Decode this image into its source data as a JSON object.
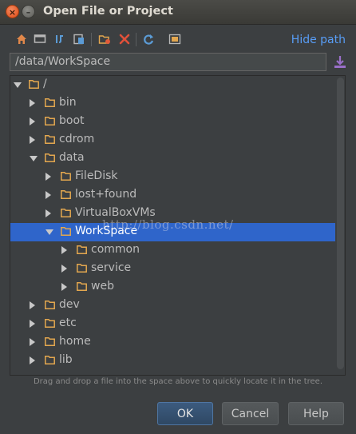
{
  "window": {
    "title": "Open File or Project",
    "close_glyph": "×",
    "minimize_glyph": "–"
  },
  "toolbar": {
    "icons": [
      "home-icon",
      "desktop-icon",
      "project-dir-icon",
      "module-dir-icon",
      "new-folder-icon",
      "delete-icon",
      "refresh-icon",
      "show-hidden-icon"
    ],
    "hide_path_label": "Hide path"
  },
  "path_field": {
    "value": "/data/WorkSpace"
  },
  "tree": {
    "items": [
      {
        "label": "/",
        "expanded": true
      },
      {
        "label": "bin",
        "expanded": false
      },
      {
        "label": "boot",
        "expanded": false
      },
      {
        "label": "cdrom",
        "expanded": false
      },
      {
        "label": "data",
        "expanded": true
      },
      {
        "label": "FileDisk",
        "expanded": false
      },
      {
        "label": "lost+found",
        "expanded": false
      },
      {
        "label": "VirtualBoxVMs",
        "expanded": false
      },
      {
        "label": "WorkSpace",
        "expanded": true,
        "selected": true
      },
      {
        "label": "common",
        "expanded": false
      },
      {
        "label": "service",
        "expanded": false
      },
      {
        "label": "web",
        "expanded": false
      },
      {
        "label": "dev",
        "expanded": false
      },
      {
        "label": "etc",
        "expanded": false
      },
      {
        "label": "home",
        "expanded": false
      },
      {
        "label": "lib",
        "expanded": false
      }
    ]
  },
  "watermark": "http://blog.csdn.net/",
  "hint": "Drag and drop a file into the space above to quickly locate it in the tree.",
  "buttons": {
    "ok": "OK",
    "cancel": "Cancel",
    "help": "Help"
  },
  "colors": {
    "selection": "#2f65ca",
    "folder": "#e3a74f",
    "link": "#589df6",
    "background": "#3c3f41"
  }
}
